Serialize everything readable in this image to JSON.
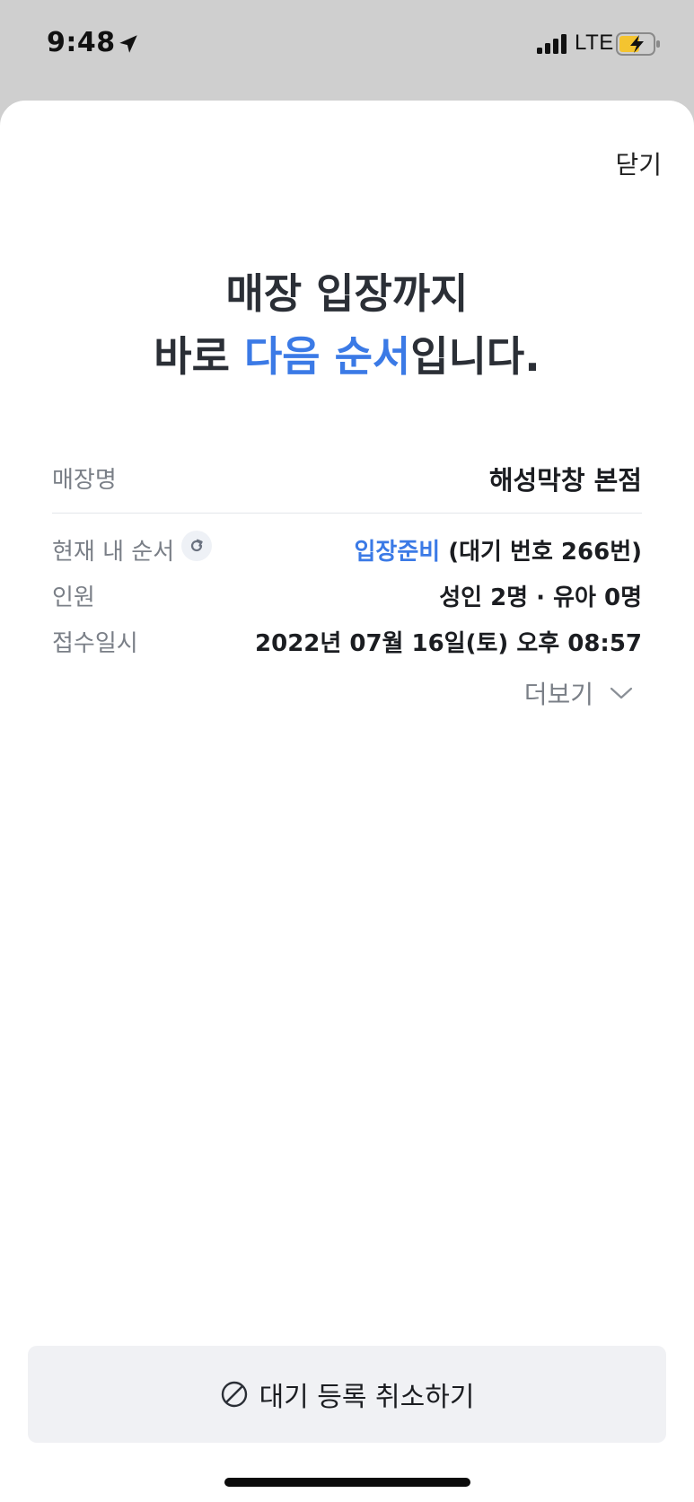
{
  "status_bar": {
    "time": "9:48",
    "network": "LTE",
    "location_icon": "location-arrow-icon",
    "signal_icon": "signal-bars-icon",
    "battery_icon": "battery-charging-icon"
  },
  "sheet": {
    "close_label": "닫기",
    "headline": {
      "line1": "매장 입장까지",
      "line2_prefix": "바로 ",
      "line2_highlight": "다음 순서",
      "line2_suffix": "입니다."
    },
    "info": {
      "store_label": "매장명",
      "store_value": "해성막창 본점",
      "order_label": "현재 내 순서",
      "order_status": "입장준비",
      "order_detail": "(대기 번호 266번)",
      "party_label": "인원",
      "party_value": "성인 2명 · 유아 0명",
      "time_label": "접수일시",
      "time_value": "2022년 07월 16일(토) 오후 08:57"
    },
    "more_label": "더보기",
    "cancel_label": "대기 등록 취소하기"
  },
  "colors": {
    "accent": "#3b7ae6",
    "text_primary": "#1b1d21",
    "text_secondary": "#7a7f87",
    "button_bg": "#f0f1f4"
  }
}
